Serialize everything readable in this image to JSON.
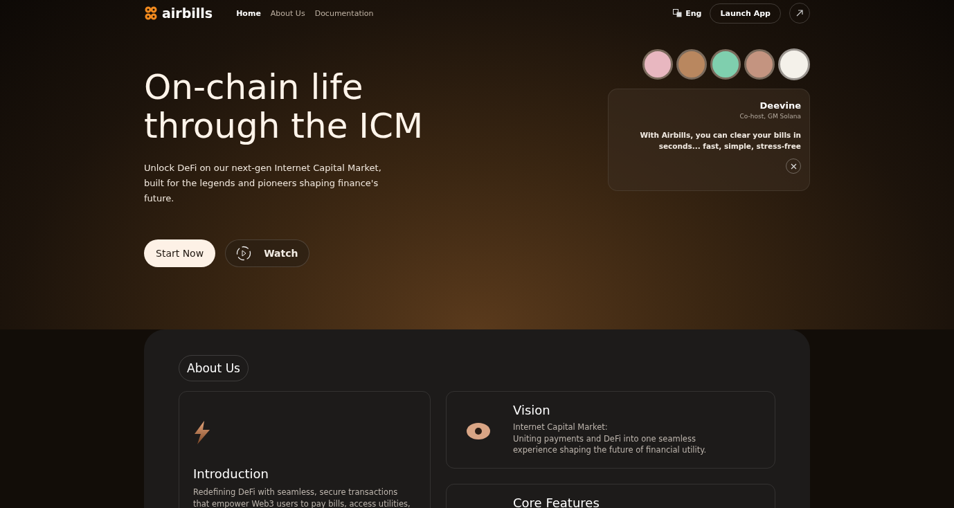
{
  "nav": {
    "logo": "airbills",
    "links": [
      {
        "label": "Home",
        "selected": true
      },
      {
        "label": "About Us",
        "selected": false
      },
      {
        "label": "Documentation",
        "selected": false
      }
    ],
    "language": "Eng",
    "launch": "Launch App"
  },
  "hero": {
    "title_lines": [
      "On-chain life",
      "through the ICM"
    ],
    "subtitle": "Unlock DeFi on our next-gen Internet Capital Market, built for the legends and pioneers shaping finance's future.",
    "primary": "Start Now",
    "secondary": "Watch"
  },
  "testimonials": {
    "avatars": [
      {
        "selected": false
      },
      {
        "selected": false
      },
      {
        "selected": false
      },
      {
        "selected": false
      },
      {
        "selected": true
      }
    ],
    "name": "Deevine",
    "role": "Co-host, GM Solana",
    "quote": "With Airbills, you can clear your bills in seconds... fast, simple, stress-free"
  },
  "about": {
    "heading": "About Us",
    "intro": {
      "title": "Introduction",
      "text": "Redefining DeFi with seamless, secure transactions that empower Web3 users to pay bills, access utilities,"
    },
    "cards": [
      {
        "title": "Vision",
        "lines": [
          "Internet Capital Market:",
          "Uniting payments and DeFi into one seamless experience shaping the future of financial utility."
        ]
      },
      {
        "title": "Core Features"
      }
    ]
  }
}
